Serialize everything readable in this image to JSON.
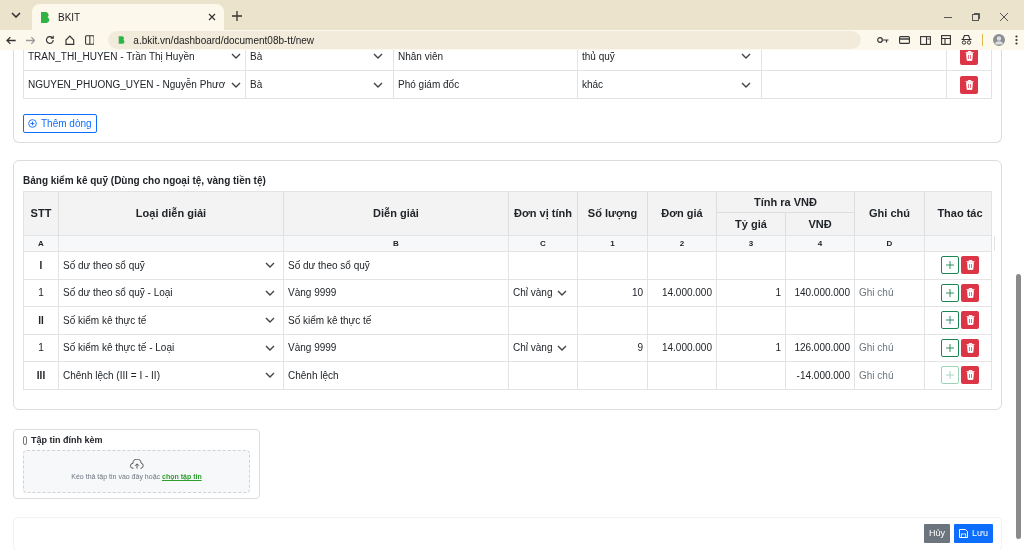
{
  "browser": {
    "tab_title": "BKIT",
    "url": "a.bkit.vn/dashboard/document08b-tt/new"
  },
  "signers": {
    "rows": [
      {
        "account": "TRAN_THI_HUYEN - Trần Thị Huyền",
        "title": "Bà",
        "position": "Nhân viên",
        "role": "thủ quỹ"
      },
      {
        "account": "NGUYEN_PHUONG_UYEN - Nguyễn Phươ",
        "title": "Bà",
        "position": "Phó giám đốc",
        "role": "khác"
      }
    ],
    "add_button": "Thêm dòng"
  },
  "inventory": {
    "title": "Bảng kiểm kê quỹ (Dùng cho ngoại tệ, vàng tiền tệ)",
    "columns": [
      {
        "label": "STT",
        "code": "A"
      },
      {
        "label": "Loại diễn giải"
      },
      {
        "label": "Diễn giải",
        "code": "B"
      },
      {
        "label": "Đơn vị tính",
        "code": "C"
      },
      {
        "label": "Số lượng",
        "code": "1"
      },
      {
        "label": "Đơn giá",
        "code": "2"
      },
      {
        "label": "Tỷ giá",
        "code": "3"
      },
      {
        "label": "VNĐ",
        "code": "4"
      },
      {
        "label": "Ghi chú",
        "code": "D"
      },
      {
        "label": "Thao tác"
      }
    ],
    "group_header": "Tính ra VNĐ",
    "rows": [
      {
        "kind": "group",
        "stt": "I",
        "type": "Số dư theo sổ quỹ",
        "description": "Số dư theo sổ quỹ",
        "add_disabled": false
      },
      {
        "kind": "item",
        "stt": "1",
        "type": "Số dư theo sổ quỹ - Loại",
        "description": "Vàng 9999",
        "unit": "Chỉ vàng",
        "quantity": "10",
        "price": "14.000.000",
        "rate": "1",
        "amount": "140.000.000",
        "note_placeholder": "Ghi chú",
        "add_disabled": false
      },
      {
        "kind": "group",
        "stt": "II",
        "type": "Số kiểm kê thực tế",
        "description": "Số kiểm kê thực tế",
        "add_disabled": false
      },
      {
        "kind": "item",
        "stt": "1",
        "type": "Số kiểm kê thực tế - Loại",
        "description": "Vàng 9999",
        "unit": "Chỉ vàng",
        "quantity": "9",
        "price": "14.000.000",
        "rate": "1",
        "amount": "126.000.000",
        "note_placeholder": "Ghi chú",
        "add_disabled": false
      },
      {
        "kind": "group",
        "stt": "III",
        "type": "Chênh lệch (III = I - II)",
        "description": "Chênh lệch",
        "amount": "-14.000.000",
        "note_placeholder": "Ghi chú",
        "add_disabled": true
      }
    ]
  },
  "attachments": {
    "title": "Tập tin đính kèm",
    "hint": "Kéo thả tập tin vào đây hoặc",
    "link": "chọn tập tin"
  },
  "footer": {
    "cancel": "Hủy",
    "save": "Lưu"
  }
}
